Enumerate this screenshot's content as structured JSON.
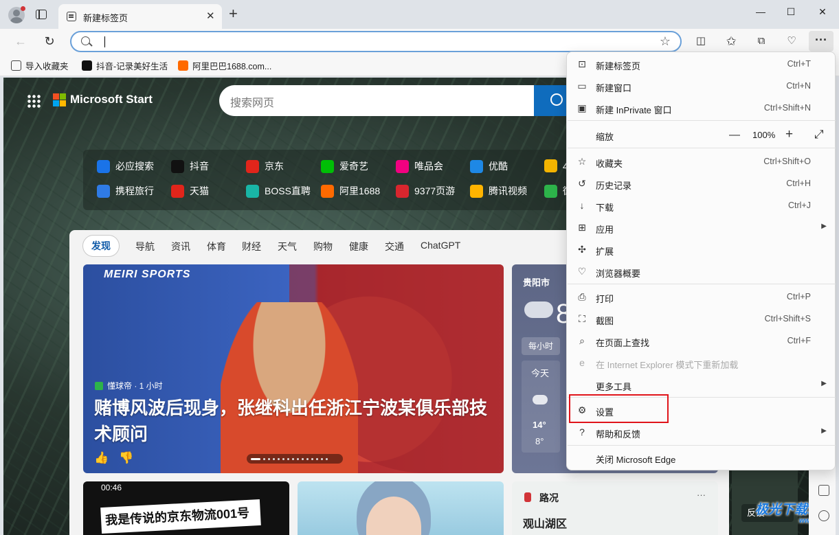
{
  "browser": {
    "tab": {
      "title": "新建标签页",
      "close": "✕"
    },
    "new_tab": "+",
    "window_controls": {
      "minimize": "—",
      "maximize": "☐",
      "close": "✕"
    },
    "address": {
      "value": "",
      "placeholder": ""
    },
    "favorites": [
      {
        "label": "导入收藏夹",
        "icon": "favorites-import-icon",
        "color": "#444444"
      },
      {
        "label": "抖音-记录美好生活",
        "icon": "douyin-icon",
        "color": "#111111"
      },
      {
        "label": "阿里巴巴1688.com...",
        "icon": "alibaba-icon",
        "color": "#ff6a00"
      }
    ]
  },
  "page": {
    "brand": "Microsoft Start",
    "search_placeholder": "搜索网页",
    "quick_links": [
      {
        "label": "必应搜索",
        "color": "#1a73e8"
      },
      {
        "label": "抖音",
        "color": "#111111"
      },
      {
        "label": "京东",
        "color": "#e1251b"
      },
      {
        "label": "爱奇艺",
        "color": "#00be06"
      },
      {
        "label": "唯品会",
        "color": "#f10180"
      },
      {
        "label": "优酷",
        "color": "#1e88e5"
      },
      {
        "label": "携程旅行",
        "color": "#2f7be5"
      },
      {
        "label": "天猫",
        "color": "#e1251b"
      },
      {
        "label": "BOSS直聘",
        "color": "#19b5a6"
      },
      {
        "label": "阿里1688",
        "color": "#ff6a00"
      },
      {
        "label": "9377页游",
        "color": "#d8262e"
      },
      {
        "label": "腾讯视频",
        "color": "#ffb400"
      }
    ],
    "quick_partial": [
      {
        "label": "4",
        "color": "#f4b400"
      },
      {
        "label": "微",
        "color": "#2db34a"
      }
    ],
    "nav": [
      "发现",
      "导航",
      "资讯",
      "体育",
      "财经",
      "天气",
      "购物",
      "健康",
      "交通",
      "ChatGPT"
    ],
    "hero": {
      "brand": "MEIRI SPORTS",
      "source": "懂球帝 · 1 小时",
      "headline": "赌博风波后现身，张继科出任浙江宁波某俱乐部技术顾问",
      "like": "👍",
      "dislike": "👎"
    },
    "weather": {
      "city": "贵阳市",
      "temp": "8",
      "hourly": "每小时",
      "day": "今天",
      "high": "14°",
      "low": "8°"
    },
    "cards": {
      "video_time": "00:46",
      "video_banner": "我是传说的京东物流001号",
      "traffic_title": "路况",
      "traffic_place": "观山湖区"
    },
    "feedback": "反馈",
    "watermark": "极光下载站",
    "watermark_url": "www.xz7.com"
  },
  "menu": {
    "items": [
      {
        "label": "新建标签页",
        "shortcut": "Ctrl+T",
        "icon": "new-tab-icon"
      },
      {
        "label": "新建窗口",
        "shortcut": "Ctrl+N",
        "icon": "new-window-icon"
      },
      {
        "label": "新建 InPrivate 窗口",
        "shortcut": "Ctrl+Shift+N",
        "icon": "inprivate-icon"
      },
      {
        "label": "缩放",
        "value": "100%",
        "icon": "zoom-icon"
      },
      {
        "label": "收藏夹",
        "shortcut": "Ctrl+Shift+O",
        "icon": "favorites-icon"
      },
      {
        "label": "历史记录",
        "shortcut": "Ctrl+H",
        "icon": "history-icon"
      },
      {
        "label": "下载",
        "shortcut": "Ctrl+J",
        "icon": "download-icon"
      },
      {
        "label": "应用",
        "shortcut": "",
        "icon": "apps-icon"
      },
      {
        "label": "扩展",
        "shortcut": "",
        "icon": "extensions-icon"
      },
      {
        "label": "浏览器概要",
        "shortcut": "",
        "icon": "browser-essentials-icon"
      },
      {
        "label": "打印",
        "shortcut": "Ctrl+P",
        "icon": "print-icon"
      },
      {
        "label": "截图",
        "shortcut": "Ctrl+Shift+S",
        "icon": "screenshot-icon"
      },
      {
        "label": "在页面上查找",
        "shortcut": "Ctrl+F",
        "icon": "find-icon"
      },
      {
        "label": "在 Internet Explorer 模式下重新加载",
        "shortcut": "",
        "icon": "ie-mode-icon"
      },
      {
        "label": "更多工具",
        "shortcut": "",
        "icon": "more-tools-icon"
      },
      {
        "label": "设置",
        "shortcut": "",
        "icon": "settings-icon"
      },
      {
        "label": "帮助和反馈",
        "shortcut": "",
        "icon": "help-icon"
      },
      {
        "label": "关闭 Microsoft Edge",
        "shortcut": "",
        "icon": "close-edge-icon"
      }
    ]
  },
  "colors": {
    "accent": "#0f6cbd",
    "highlight_box": "#e0141a",
    "menu_bg": "#fbfbfb",
    "tab_bg": "#dfe3e8"
  }
}
